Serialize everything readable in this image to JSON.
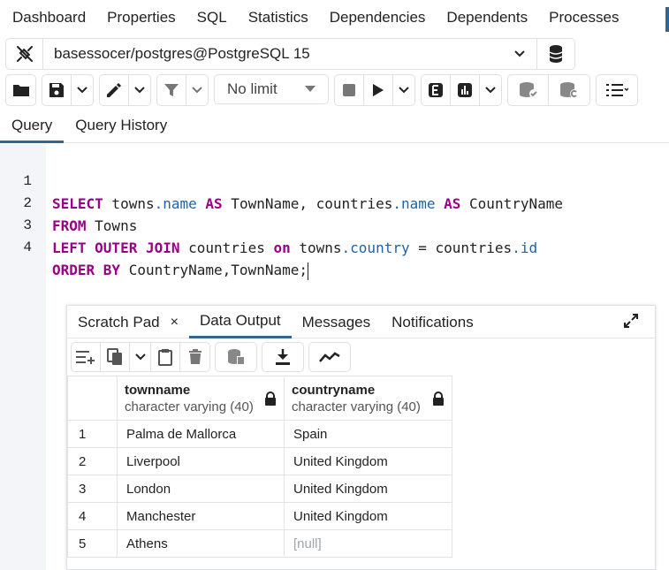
{
  "top_tabs": [
    "Dashboard",
    "Properties",
    "SQL",
    "Statistics",
    "Dependencies",
    "Dependents",
    "Processes"
  ],
  "connection": {
    "value": "basessocer/postgres@PostgreSQL 15"
  },
  "toolbar": {
    "limit_label": "No limit"
  },
  "query_tabs": {
    "query": "Query",
    "history": "Query History"
  },
  "editor": {
    "line_numbers": [
      "1",
      "2",
      "3",
      "4"
    ],
    "lines": [
      [
        [
          "kw",
          "SELECT"
        ],
        [
          "t",
          " towns"
        ],
        [
          "p",
          ".name"
        ],
        [
          "t",
          " "
        ],
        [
          "kw",
          "AS"
        ],
        [
          "t",
          " TownName, countries"
        ],
        [
          "p",
          ".name"
        ],
        [
          "t",
          " "
        ],
        [
          "kw",
          "AS"
        ],
        [
          "t",
          " CountryName"
        ]
      ],
      [
        [
          "kw",
          "FROM"
        ],
        [
          "t",
          " Towns"
        ]
      ],
      [
        [
          "kw",
          "LEFT OUTER JOIN"
        ],
        [
          "t",
          " countries "
        ],
        [
          "kw",
          "on"
        ],
        [
          "t",
          " towns"
        ],
        [
          "p",
          ".country"
        ],
        [
          "t",
          " = countries"
        ],
        [
          "p",
          ".id"
        ]
      ],
      [
        [
          "kw",
          "ORDER BY"
        ],
        [
          "t",
          " CountryName,TownName;"
        ]
      ]
    ]
  },
  "result_panel": {
    "tabs": {
      "scratch": "Scratch Pad",
      "close": "×",
      "data": "Data Output",
      "messages": "Messages",
      "notifications": "Notifications"
    },
    "columns": [
      {
        "name": "townname",
        "type": "character varying (40)"
      },
      {
        "name": "countryname",
        "type": "character varying (40)"
      }
    ],
    "rows": [
      {
        "n": "1",
        "town": "Palma de Mallorca",
        "country": "Spain"
      },
      {
        "n": "2",
        "town": "Liverpool",
        "country": "United Kingdom"
      },
      {
        "n": "3",
        "town": "London",
        "country": "United Kingdom"
      },
      {
        "n": "4",
        "town": "Manchester",
        "country": "United Kingdom"
      },
      {
        "n": "5",
        "town": "Athens",
        "country": "[null]"
      }
    ]
  },
  "colors": {
    "accent": "#326690",
    "keyword": "#990099",
    "property": "#1e63a8",
    "null_text": "#a0a4ab"
  }
}
